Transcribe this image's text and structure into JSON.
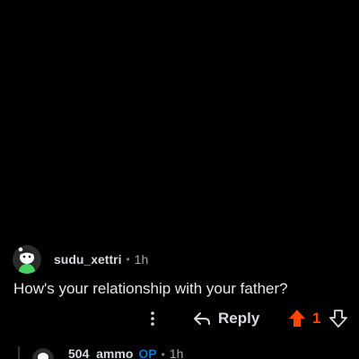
{
  "comment": {
    "username": "sudu_xettri",
    "separator": "•",
    "timestamp": "1h",
    "body": "How's your relationship with your father?",
    "avatar_icon": "snoo-avatar-icon",
    "actions": {
      "more_icon": "more-vertical-icon",
      "reply_icon": "reply-arrow-icon",
      "reply_label": "Reply",
      "upvote_icon": "upvote-arrow-icon",
      "vote_count": "1",
      "downvote_icon": "downvote-arrow-icon",
      "upvote_active": true
    }
  },
  "reply": {
    "username": "504_ammo",
    "op_badge": "OP",
    "separator": "•",
    "timestamp": "1h",
    "avatar_icon": "snoo-avatar-icon"
  },
  "colors": {
    "background": "#000000",
    "upvote_active": "#ff4500",
    "op_badge": "#0079d3",
    "text_primary": "#d7dadc",
    "text_muted": "#a8aaab",
    "avatar_accent": "#46d160"
  }
}
